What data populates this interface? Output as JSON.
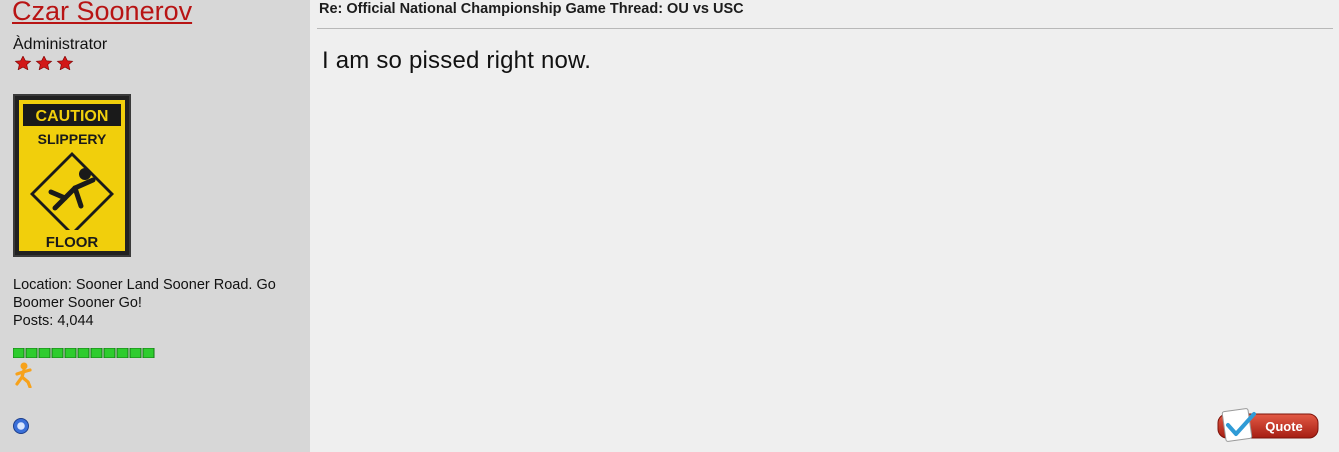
{
  "user": {
    "username": "Czar Soonerov",
    "title": "Àdministrator",
    "rank_icon": "three-red-stars-icon",
    "avatar": {
      "top_text": "CAUTION",
      "middle_text": "SLIPPERY",
      "bottom_text": "FLOOR"
    },
    "location_line": "Location: Sooner Land Sooner Road. Go Boomer Sooner Go!",
    "posts_line": "Posts: 4,044",
    "post_bar_segments": 11,
    "aim_icon": "aim-running-man-icon",
    "online_icon": "online-status-icon"
  },
  "post": {
    "title": "Re: Official National Championship Game Thread: OU vs USC",
    "body": "I am so pissed right now.",
    "quote_label": "Quote"
  },
  "colors": {
    "sidebar_bg": "#d7d7d7",
    "main_bg": "#efefef",
    "username": "#b81414",
    "quote_button": "#c0392b",
    "post_bar": "#2ecc2e"
  }
}
